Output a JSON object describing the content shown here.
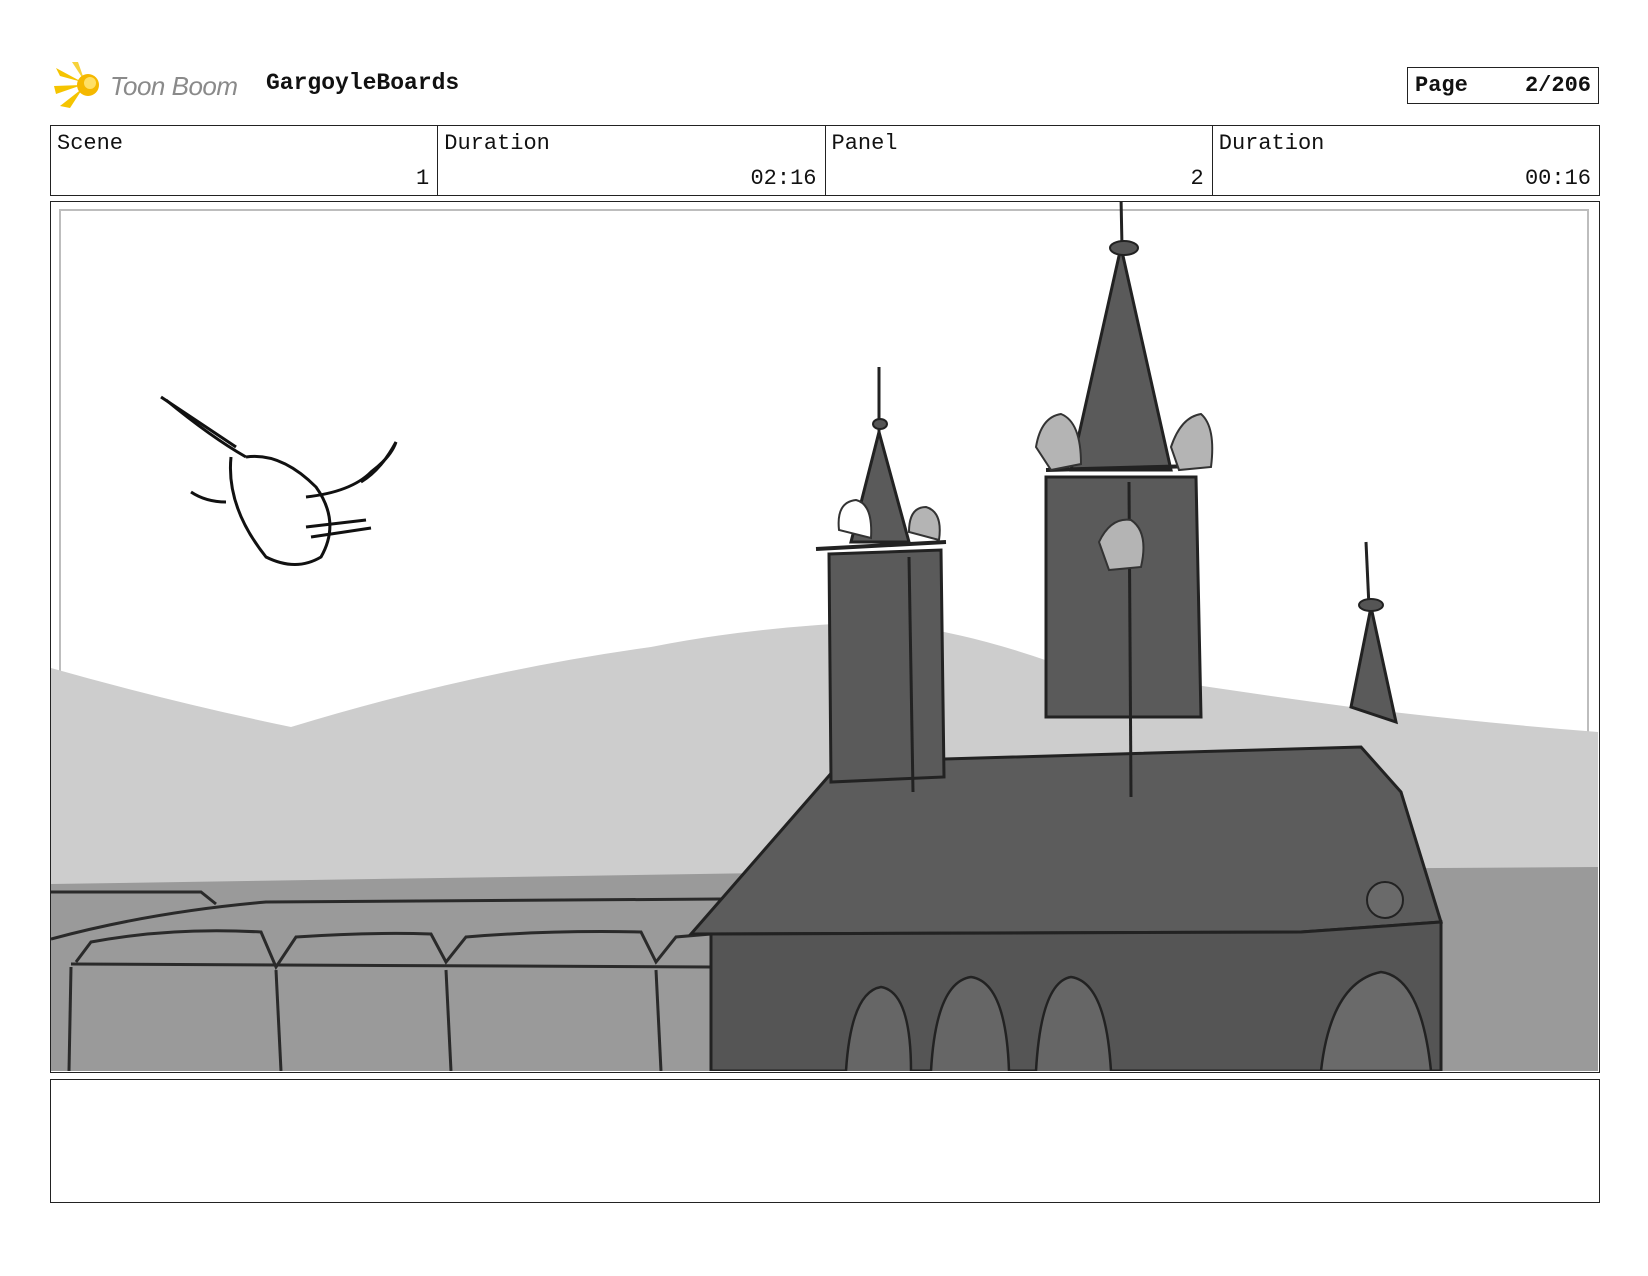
{
  "header": {
    "logo_text": "Toon Boom",
    "project_title": "GargoyleBoards",
    "page_label": "Page",
    "page_value": "2/206"
  },
  "info": {
    "scene_label": "Scene",
    "scene_value": "1",
    "scene_duration_label": "Duration",
    "scene_duration_value": "02:16",
    "panel_label": "Panel",
    "panel_value": "2",
    "panel_duration_label": "Duration",
    "panel_duration_value": "00:16"
  },
  "notes": {
    "text": ""
  },
  "colors": {
    "logo_star": "#f5c400",
    "logo_text": "#8a8a8a",
    "hills": "#cdcdcd",
    "ground": "#9a9a9a",
    "building": "#5c5c5c",
    "building_dark": "#4e4e4e",
    "gargoyle": "#b4b4b4"
  }
}
